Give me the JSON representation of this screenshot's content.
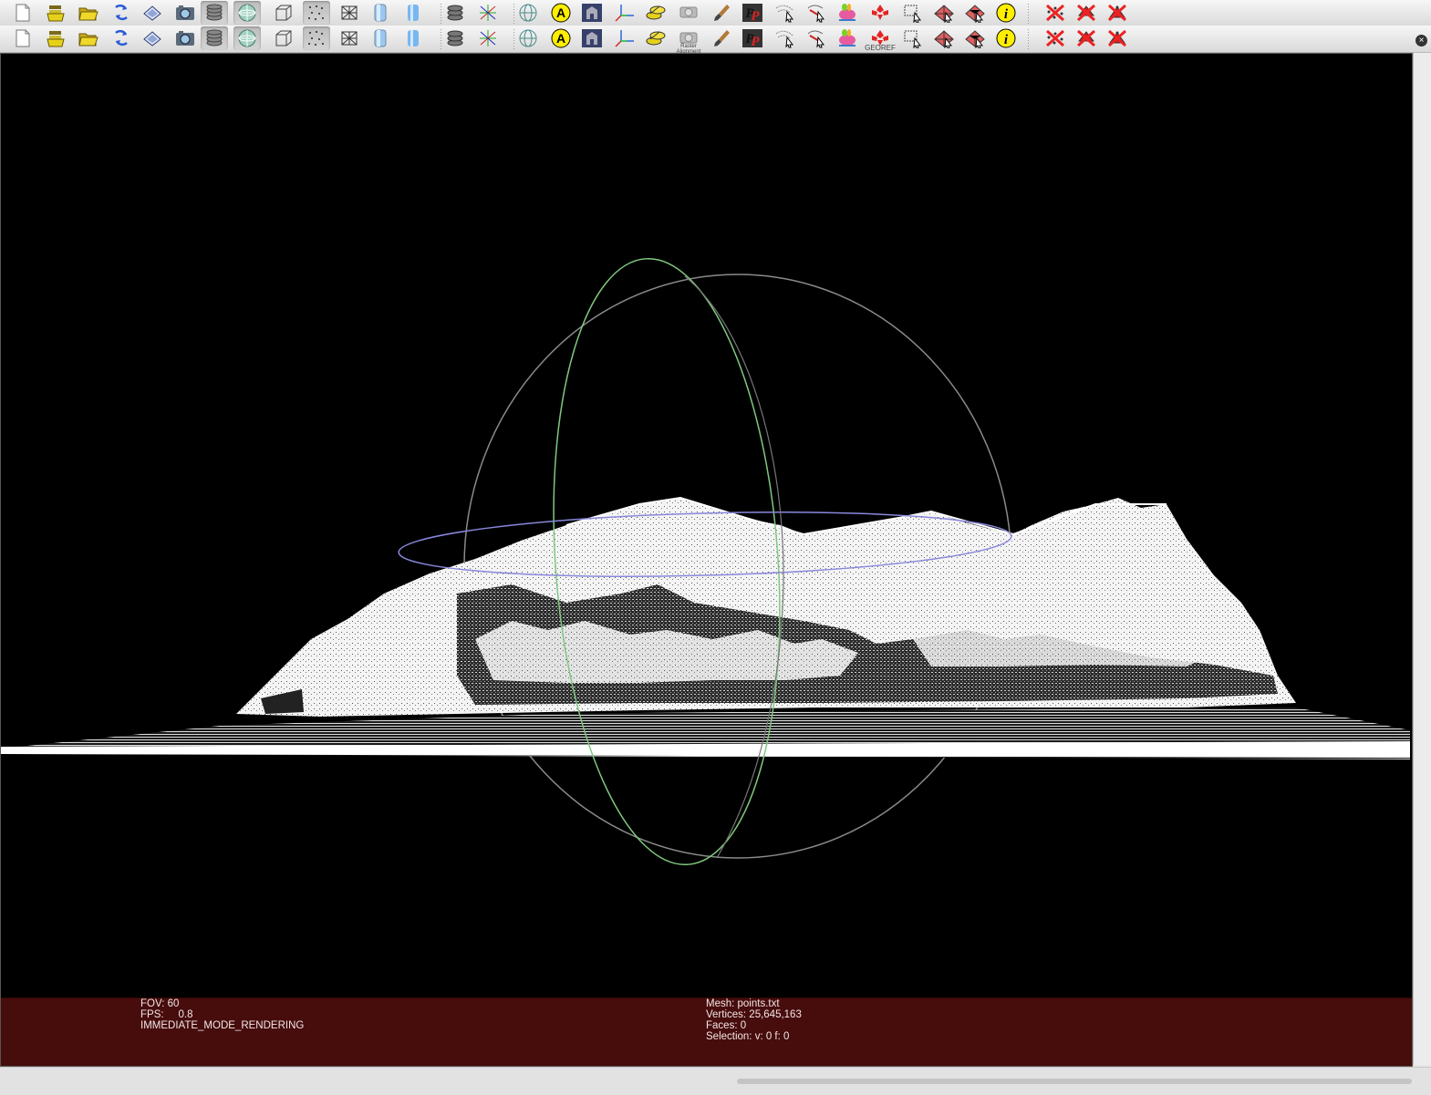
{
  "toolbar": {
    "buttons": [
      {
        "name": "new-icon",
        "tooltip": "New"
      },
      {
        "name": "import-layers-icon",
        "tooltip": "Import"
      },
      {
        "name": "open-folder-icon",
        "tooltip": "Open"
      },
      {
        "name": "reload-icon",
        "tooltip": "Reload"
      },
      {
        "name": "save-icon",
        "tooltip": "Save"
      },
      {
        "name": "snapshot-icon",
        "tooltip": "Snapshot"
      },
      {
        "name": "layers-icon",
        "tooltip": "Layers"
      },
      {
        "name": "decoration-sphere-icon",
        "tooltip": "Decoration"
      },
      {
        "name": "bounding-box-icon",
        "tooltip": "Bounding box"
      },
      {
        "name": "points-icon",
        "tooltip": "Points"
      },
      {
        "name": "wireframe-icon",
        "tooltip": "Wireframe"
      },
      {
        "name": "flat-shading-icon",
        "tooltip": "Flat"
      },
      {
        "name": "smooth-shading-icon",
        "tooltip": "Smooth"
      },
      {
        "name": "color-layers-icon",
        "tooltip": "Color"
      },
      {
        "name": "axes-transform-icon",
        "tooltip": "Transform"
      },
      {
        "name": "trackball-globe-icon",
        "tooltip": "Trackball"
      },
      {
        "name": "annotation-a-icon",
        "tooltip": "Annotation"
      },
      {
        "name": "temple-image-icon",
        "tooltip": "Raster"
      },
      {
        "name": "axis-frame-icon",
        "tooltip": "Axis"
      },
      {
        "name": "coin-stack-icon",
        "tooltip": "Quality"
      },
      {
        "name": "camera-icon",
        "tooltip": "Raster Alignment"
      },
      {
        "name": "paint-brush-icon",
        "tooltip": "Paint"
      },
      {
        "name": "pp-icon",
        "tooltip": "PickPoints"
      },
      {
        "name": "pick-points-icon",
        "tooltip": "Pick"
      },
      {
        "name": "measure-icon",
        "tooltip": "Measure"
      },
      {
        "name": "bunny-icon",
        "tooltip": "Bunny"
      },
      {
        "name": "georef-icon",
        "tooltip": "Georef"
      },
      {
        "name": "select-rect-icon",
        "tooltip": "Select"
      },
      {
        "name": "select-faces-icon",
        "tooltip": "Select faces"
      },
      {
        "name": "select-connected-icon",
        "tooltip": "Select connected"
      },
      {
        "name": "info-icon",
        "tooltip": "Info"
      },
      {
        "name": "delete-vertices-icon",
        "tooltip": "Delete vertices"
      },
      {
        "name": "delete-faces-icon",
        "tooltip": "Delete faces"
      },
      {
        "name": "delete-all-icon",
        "tooltip": "Delete all"
      }
    ],
    "captions": {
      "raster_align": "Raster Alignment",
      "georef": "GEOREF"
    }
  },
  "info_left": {
    "fov": "FOV: 60",
    "fps": "FPS:     0.8",
    "mode": "IMMEDIATE_MODE_RENDERING"
  },
  "info_right": {
    "mesh": "Mesh: points.txt",
    "vertices": "Vertices: 25,645,163",
    "faces": "Faces: 0",
    "selection": "Selection: v: 0 f: 0"
  },
  "colors": {
    "viewport_bg": "#000000",
    "info_bar_bg": "#470c0c",
    "trackball_green": "#7fc97f",
    "trackball_blue": "#8888dd",
    "trackball_gray": "#8a8a8a"
  }
}
